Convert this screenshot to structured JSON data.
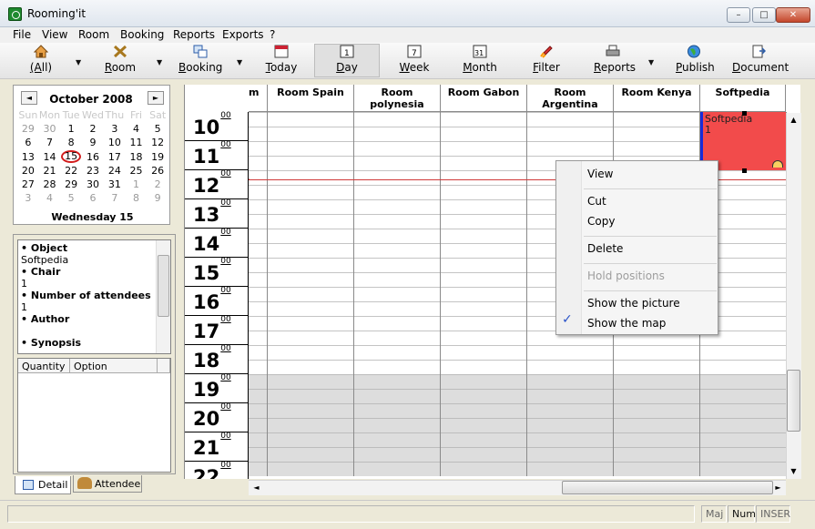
{
  "window": {
    "title": "Rooming'it",
    "min": "–",
    "max": "□",
    "close": "✕"
  },
  "menu": [
    "File",
    "View",
    "Room",
    "Booking",
    "Reports",
    "Exports",
    "?"
  ],
  "toolbar": {
    "all": "(All)",
    "room": "Room",
    "booking": "Booking",
    "today": "Today",
    "day": "Day",
    "week": "Week",
    "month": "Month",
    "filter": "Filter",
    "reports": "Reports",
    "publish": "Publish",
    "document": "Document",
    "dropdown": "▼"
  },
  "calendar": {
    "month": "October 2008",
    "prev": "◄",
    "next": "►",
    "weekdays": [
      "Sun",
      "Mon",
      "Tue",
      "Wed",
      "Thu",
      "Fri",
      "Sat"
    ],
    "weeks": [
      [
        "29",
        "30",
        "1",
        "2",
        "3",
        "4",
        "5"
      ],
      [
        "6",
        "7",
        "8",
        "9",
        "10",
        "11",
        "12"
      ],
      [
        "13",
        "14",
        "15",
        "16",
        "17",
        "18",
        "19"
      ],
      [
        "20",
        "21",
        "22",
        "23",
        "24",
        "25",
        "26"
      ],
      [
        "27",
        "28",
        "29",
        "30",
        "31",
        "1",
        "2"
      ],
      [
        "3",
        "4",
        "5",
        "6",
        "7",
        "8",
        "9"
      ]
    ],
    "selected_label": "Wednesday 15"
  },
  "detail": {
    "object_label": "• Object",
    "object_value": "Softpedia",
    "chair_label": "• Chair",
    "chair_value": "1",
    "attendees_label": "• Number of attendees",
    "attendees_value": "1",
    "author_label": "• Author",
    "author_value": "",
    "synopsis_label": "• Synopsis"
  },
  "options": {
    "col_quantity": "Quantity",
    "col_option": "Option"
  },
  "tabs": {
    "detail": "Detail",
    "attendee": "Attendee"
  },
  "grid": {
    "columns": [
      "m",
      "Room Spain",
      "Room polynesia",
      "Room Gabon",
      "Room Argentina",
      "Room Kenya",
      "Softpedia"
    ],
    "hours": [
      "10",
      "11",
      "12",
      "13",
      "14",
      "15",
      "16",
      "17",
      "18",
      "19",
      "20",
      "21",
      "22"
    ],
    "minutes": "00",
    "event": {
      "title": "Softpedia",
      "count": "1"
    }
  },
  "context_menu": {
    "view": "View",
    "cut": "Cut",
    "copy": "Copy",
    "delete": "Delete",
    "hold": "Hold positions",
    "picture": "Show the picture",
    "map": "Show the map"
  },
  "status": {
    "maj": "Maj",
    "num": "Num",
    "ins": "INSER"
  }
}
